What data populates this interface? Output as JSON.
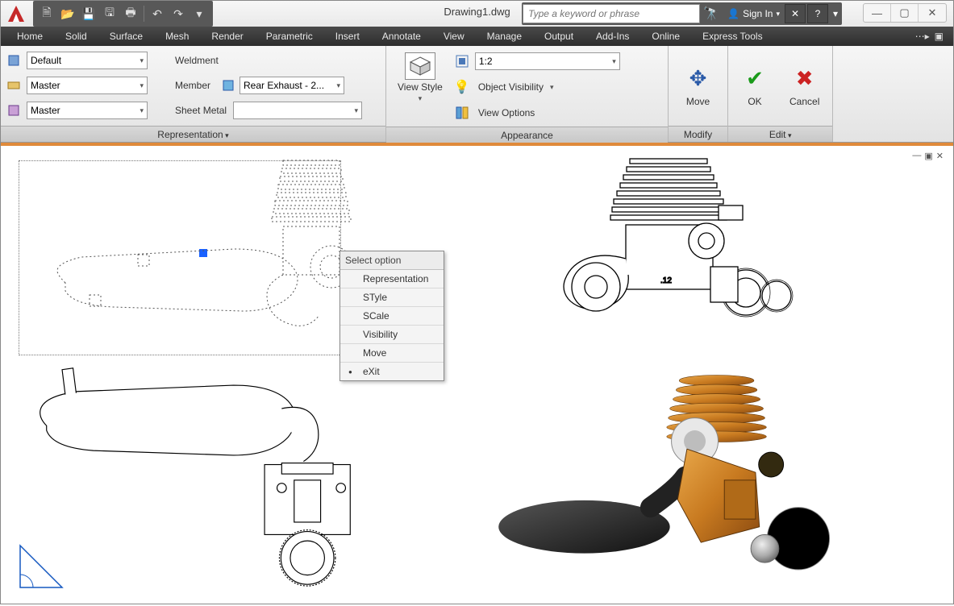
{
  "window": {
    "title": "Drawing1.dwg"
  },
  "search": {
    "placeholder": "Type a keyword or phrase"
  },
  "signin": {
    "label": "Sign In"
  },
  "menubar": {
    "tabs": [
      "Home",
      "Solid",
      "Surface",
      "Mesh",
      "Render",
      "Parametric",
      "Insert",
      "Annotate",
      "View",
      "Manage",
      "Output",
      "Add-Ins",
      "Online",
      "Express Tools"
    ]
  },
  "panels": {
    "representation": {
      "title": "Representation",
      "rows": {
        "r1_label": "Default",
        "r1_side": "Weldment",
        "r2_label": "Master",
        "r2_side": "Member",
        "r2_combo2": "Rear Exhaust - 2...",
        "r3_label": "Master",
        "r3_side": "Sheet Metal"
      }
    },
    "appearance": {
      "title": "Appearance",
      "view_style": "View Style",
      "scale": "1:2",
      "visibility": "Object Visibility",
      "options": "View Options"
    },
    "modify": {
      "title": "Modify",
      "move": "Move"
    },
    "edit": {
      "title": "Edit",
      "ok": "OK",
      "cancel": "Cancel"
    }
  },
  "context_menu": {
    "header": "Select option",
    "items": [
      "Representation",
      "STyle",
      "SCale",
      "Visibility",
      "Move",
      "eXit"
    ]
  },
  "canvas": {
    "engine_label": ".12"
  }
}
